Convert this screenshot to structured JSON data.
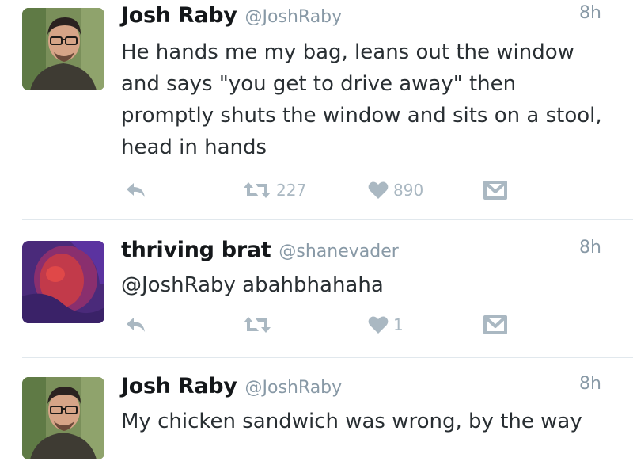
{
  "tweets": [
    {
      "name": "Josh Raby",
      "handle": "@JoshRaby",
      "time": "8h",
      "text": "He hands me my bag, leans out the window and says \"you get to drive away\" then promptly shuts the window and sits on a stool, head in hands",
      "retweets": "227",
      "likes": "890",
      "avatar_icon": "man-with-glasses-avatar"
    },
    {
      "name": "thriving brat",
      "handle": "@shanevader",
      "time": "8h",
      "text": "@JoshRaby abahbhahaha",
      "retweets": "",
      "likes": "1",
      "avatar_icon": "purple-red-abstract-avatar"
    },
    {
      "name": "Josh Raby",
      "handle": "@JoshRaby",
      "time": "8h",
      "text": "My chicken sandwich was wrong, by the way",
      "avatar_icon": "man-with-glasses-avatar"
    }
  ],
  "colors": {
    "name": "#14171a",
    "muted": "#8899a6",
    "icon": "#aab8c2",
    "divider": "#e1e8ed"
  },
  "icons": {
    "reply": "reply-arrow-icon",
    "retweet": "retweet-icon",
    "like": "heart-icon",
    "message": "envelope-icon"
  }
}
